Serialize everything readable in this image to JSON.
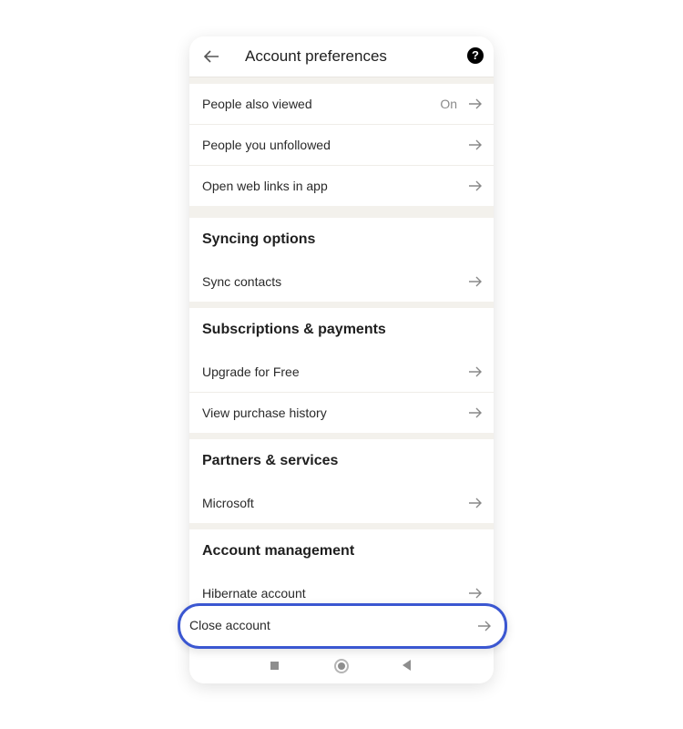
{
  "header": {
    "title": "Account preferences",
    "help_glyph": "?"
  },
  "general": {
    "items": [
      {
        "label": "People also viewed",
        "value": "On"
      },
      {
        "label": "People you unfollowed"
      },
      {
        "label": "Open web links in app"
      }
    ]
  },
  "syncing": {
    "title": "Syncing options",
    "items": [
      {
        "label": "Sync contacts"
      }
    ]
  },
  "subscriptions": {
    "title": "Subscriptions & payments",
    "items": [
      {
        "label": "Upgrade for Free"
      },
      {
        "label": "View purchase history"
      }
    ]
  },
  "partners": {
    "title": "Partners & services",
    "items": [
      {
        "label": "Microsoft"
      }
    ]
  },
  "management": {
    "title": "Account management",
    "items": [
      {
        "label": "Hibernate account"
      },
      {
        "label": "Close account"
      }
    ]
  },
  "colors": {
    "highlight": "#3b57d1",
    "section_gap": "#f3f1ec"
  }
}
